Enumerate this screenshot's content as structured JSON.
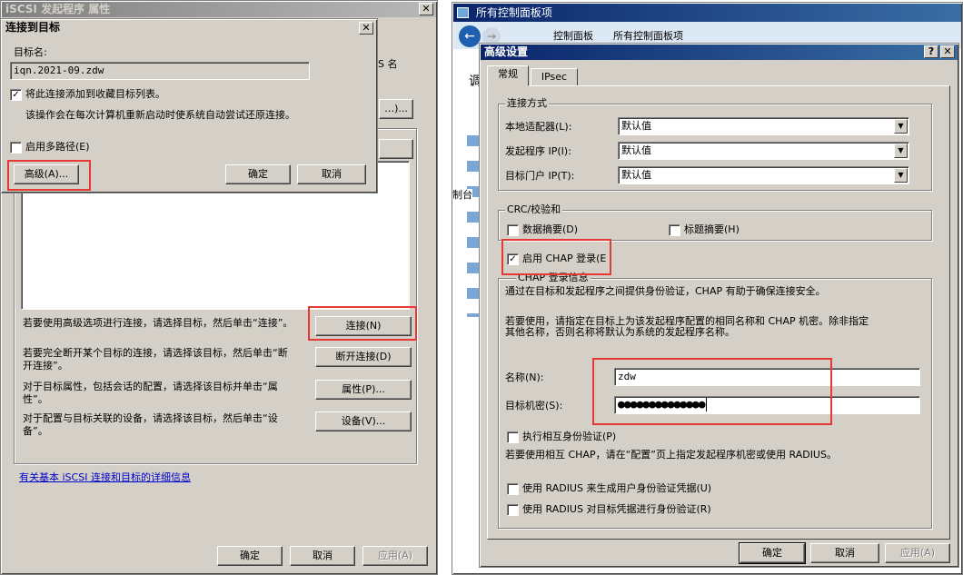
{
  "props_window": {
    "title": "iSCSI 发起程序 属性",
    "close_glyph": "✕",
    "partial_label_right": "S 名",
    "partial_btn_right": "…)...",
    "info_rows": [
      {
        "text": "若要使用高级选项进行连接，请选择目标，然后单击“连接”。",
        "button": "连接(N)"
      },
      {
        "text": "若要完全断开某个目标的连接，请选择该目标，然后单击“断开连接”。",
        "button": "断开连接(D)"
      },
      {
        "text": "对于目标属性，包括会话的配置，请选择该目标并单击“属性”。",
        "button": "属性(P)..."
      },
      {
        "text": "对于配置与目标关联的设备，请选择该目标，然后单击“设备”。",
        "button": "设备(V)..."
      }
    ],
    "link": "有关基本 iSCSI 连接和目标的详细信息",
    "ok": "确定",
    "cancel": "取消",
    "apply": "应用(A)"
  },
  "connect_dialog": {
    "title": "连接到目标",
    "close_glyph": "✕",
    "target_name_label": "目标名:",
    "target_name_value": "iqn.2021-09.zdw",
    "favorites_label": "将此连接添加到收藏目标列表。",
    "favorites_checked": true,
    "favorites_desc": "该操作会在每次计算机重新启动时使系统自动尝试还原连接。",
    "multipath_label": "启用多路径(E)",
    "multipath_checked": false,
    "advanced": "高级(A)...",
    "ok": "确定",
    "cancel": "取消"
  },
  "control_panel": {
    "title": "所有控制面板项",
    "breadcrumb_1": "控制面板",
    "breadcrumb_2": "所有控制面板项",
    "partial_heading": "调",
    "partial_side": "制台"
  },
  "advanced_dialog": {
    "title": "高级设置",
    "help_glyph": "?",
    "close_glyph": "✕",
    "tabs": [
      "常规",
      "IPsec"
    ],
    "connect_group": "连接方式",
    "local_adapter_label": "本地适配器(L):",
    "local_adapter_value": "默认值",
    "initiator_ip_label": "发起程序 IP(I):",
    "initiator_ip_value": "默认值",
    "portal_ip_label": "目标门户 IP(T):",
    "portal_ip_value": "默认值",
    "crc_group": "CRC/校验和",
    "data_digest": "数据摘要(D)",
    "header_digest": "标题摘要(H)",
    "chap_label": "启用 CHAP 登录(E",
    "chap_checked": true,
    "chap_group": "CHAP 登录信息",
    "chap_desc": "通过在目标和发起程序之间提供身份验证，CHAP 有助于确保连接安全。",
    "chap_usage_1": "若要使用，请指定在目标上为该发起程序配置的相同名称和 CHAP 机密。除非指定",
    "chap_usage_2": "其他名称，否则名称将默认为系统的发起程序名称。",
    "name_label": "名称(N):",
    "name_value": "zdw",
    "secret_label": "目标机密(S):",
    "secret_value": "●●●●●●●●●●●●●●",
    "mutual_label": "执行相互身份验证(P)",
    "mutual_desc": "若要使用相互 CHAP，请在“配置”页上指定发起程序机密或使用 RADIUS。",
    "radius_user": "使用 RADIUS 来生成用户身份验证凭据(U)",
    "radius_target": "使用 RADIUS 对目标凭据进行身份验证(R)",
    "ok": "确定",
    "cancel": "取消",
    "apply": "应用(A)"
  }
}
